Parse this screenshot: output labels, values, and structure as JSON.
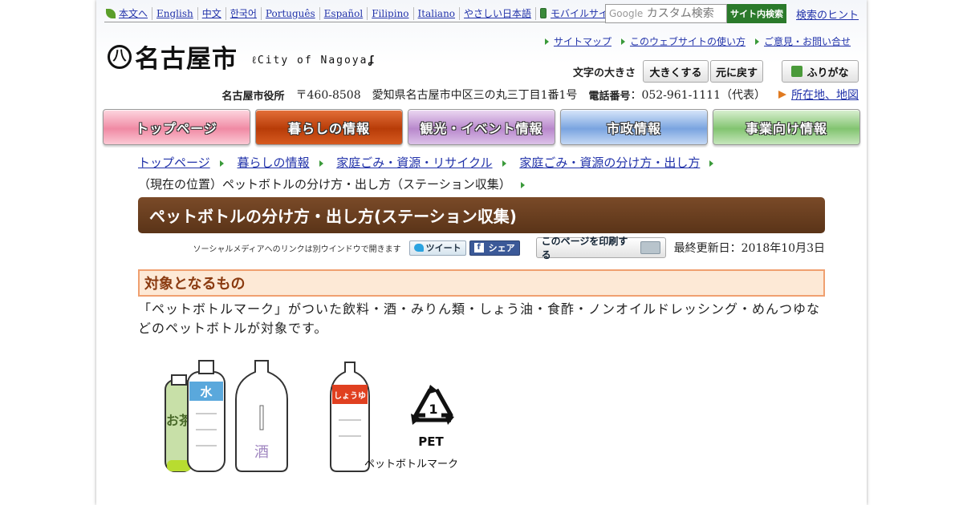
{
  "lang_links": [
    "本文へ",
    "English",
    "中文",
    "한국어",
    "Português",
    "Español",
    "Filipino",
    "Italiano",
    "やさしい日本語",
    "モバイルサイト"
  ],
  "search": {
    "placeholder": "カスタム検索",
    "google": "Google",
    "button": "サイト内検索",
    "hint": "検索のヒント"
  },
  "logo": {
    "name": "名古屋市",
    "mark": "八",
    "english": "City of Nagoya"
  },
  "util_links": [
    "サイトマップ",
    "このウェブサイトの使い方",
    "ご意見・お問い合せ"
  ],
  "text_size": {
    "label": "文字の大きさ",
    "larger": "大きくする",
    "reset": "元に戻す",
    "furigana": "ふりがな"
  },
  "address": {
    "office": "名古屋市役所",
    "postal": "〒460-8508",
    "street": "愛知県名古屋市中区三の丸三丁目1番1号",
    "phone_label": "電話番号",
    "phone": "：052-961-1111（代表）",
    "map_link": "所在地、地図"
  },
  "global_nav": [
    {
      "label": "トップページ",
      "color": "#f5a6b8"
    },
    {
      "label": "暮らしの情報",
      "color": "#c94a10"
    },
    {
      "label": "観光・イベント情報",
      "color": "#c9a0d6"
    },
    {
      "label": "市政情報",
      "color": "#8fb4e8"
    },
    {
      "label": "事業向け情報",
      "color": "#9ad08a"
    }
  ],
  "breadcrumb": [
    "トップページ",
    "暮らしの情報",
    "家庭ごみ・資源・リサイクル",
    "家庭ごみ・資源の分け方・出し方"
  ],
  "current_location": "（現在の位置）ペットボトルの分け方・出し方（ステーション収集）",
  "page_title": "ペットボトルの分け方・出し方(ステーション収集)",
  "social": {
    "note": "ソーシャルメディアへのリンクは別ウインドウで開きます",
    "tweet": "ツイート",
    "share": "シェア",
    "print": "このページを印刷する"
  },
  "last_updated": "最終更新日：2018年10月3日",
  "section_heading": "対象となるもの",
  "body_text": "「ペットボトルマーク」がついた飲料・酒・みりん類・しょう油・食酢・ノンオイルドレッシング・めんつゆなどのペットボトルが対象です。",
  "illustration": {
    "bottle_labels": [
      "お茶",
      "水",
      "酒",
      "しょうゆ"
    ],
    "pet_number": "1",
    "pet_text": "PET",
    "caption": "ペットボトルマーク"
  }
}
